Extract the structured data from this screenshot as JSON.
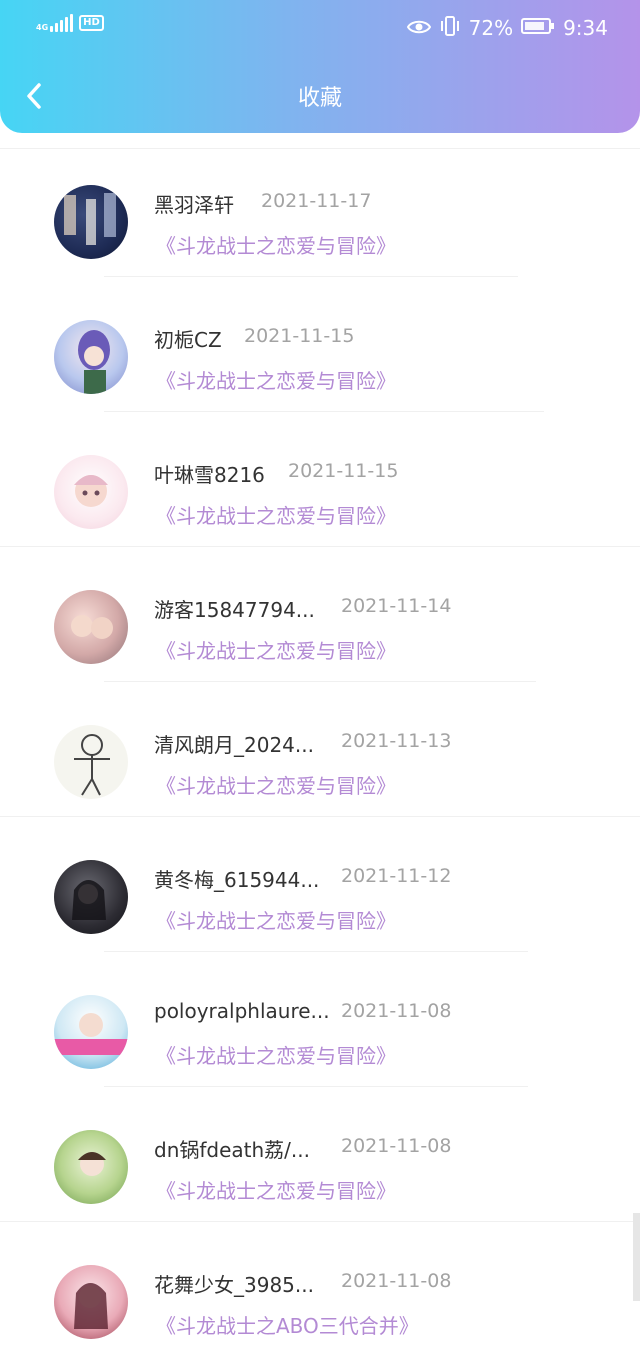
{
  "status_bar": {
    "network": "4G",
    "hd": "HD",
    "battery": "72%",
    "time": "9:34",
    "icons": [
      "signal-icon",
      "eye-icon",
      "vibrate-icon",
      "battery-icon"
    ]
  },
  "header": {
    "title": "收藏",
    "back_icon": "chevron-left-icon"
  },
  "colors": {
    "header_gradient": [
      "#46d5f4",
      "#b493ea"
    ],
    "book_title": "#b38ad4",
    "name": "#333333",
    "date": "#a3a3a3"
  },
  "favorites": [
    {
      "name": "黑羽泽轩",
      "date": "2021-11-17",
      "book": "《斗龙战士之恋爱与冒险》"
    },
    {
      "name": "初栀CZ",
      "date": "2021-11-15",
      "book": "《斗龙战士之恋爱与冒险》"
    },
    {
      "name": "叶琳雪8216",
      "date": "2021-11-15",
      "book": "《斗龙战士之恋爱与冒险》"
    },
    {
      "name": "游客15847794...",
      "date": "2021-11-14",
      "book": "《斗龙战士之恋爱与冒险》"
    },
    {
      "name": "清风朗月_2024...",
      "date": "2021-11-13",
      "book": "《斗龙战士之恋爱与冒险》"
    },
    {
      "name": "黄冬梅_615944...",
      "date": "2021-11-12",
      "book": "《斗龙战士之恋爱与冒险》"
    },
    {
      "name": "poloyralphlaure...",
      "date": "2021-11-08",
      "book": "《斗龙战士之恋爱与冒险》"
    },
    {
      "name": "dn锅fdeath荔/...",
      "date": "2021-11-08",
      "book": "《斗龙战士之恋爱与冒险》"
    },
    {
      "name": "花舞少女_3985...",
      "date": "2021-11-08",
      "book": "《斗龙战士之ABO三代合并》"
    }
  ]
}
